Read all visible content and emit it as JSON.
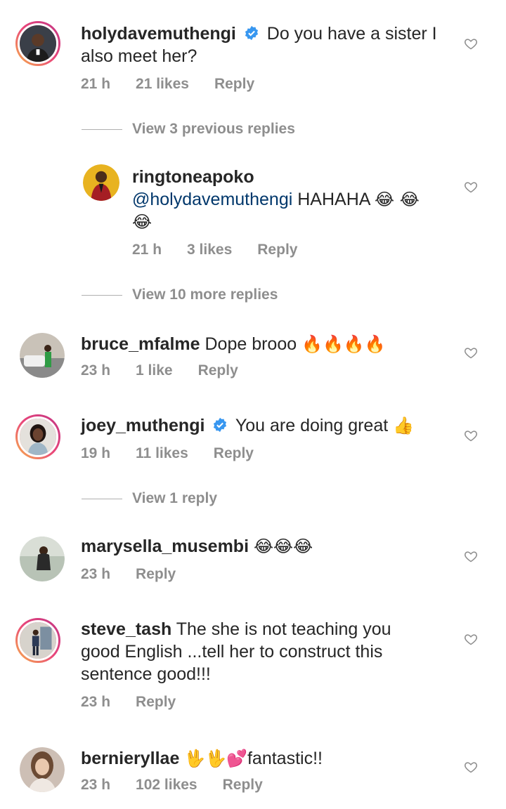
{
  "comments": [
    {
      "username": "holydavemuthengi",
      "verified": true,
      "text": "Do you have a sister I also meet her?",
      "time": "21 h",
      "likes": "21 likes",
      "reply": "Reply",
      "avatar": "man-portrait"
    },
    {
      "username": "ringtoneapoko",
      "mention": "@holydavemuthengi",
      "text": "HAHAHA",
      "emojis": "😂 😂",
      "emojis2": "😂",
      "time": "21 h",
      "likes": "3 likes",
      "reply": "Reply",
      "avatar": "man-red-suit"
    },
    {
      "username": "bruce_mfalme",
      "text": "Dope brooo",
      "emojis": "🔥🔥🔥🔥",
      "time": "23 h",
      "likes": "1 like",
      "reply": "Reply",
      "avatar": "man-with-car"
    },
    {
      "username": "joey_muthengi",
      "verified": true,
      "text": "You are doing great",
      "emojis": "👍",
      "time": "19 h",
      "likes": "11 likes",
      "reply": "Reply",
      "avatar": "woman-portrait"
    },
    {
      "username": "marysella_musembi",
      "emojis": "😂😂😂",
      "time": "23 h",
      "reply": "Reply",
      "avatar": "woman-sitting"
    },
    {
      "username": "steve_tash",
      "text_line1": "The she is not teaching you",
      "text_line2": "good English ...tell her to construct this",
      "text_line3": "sentence good!!!",
      "time": "23 h",
      "reply": "Reply",
      "avatar": "man-standing"
    },
    {
      "username": "bernieryllae",
      "emojis": "🖖🖖💕",
      "text": "fantastic!!",
      "time": "23 h",
      "likes": "102 likes",
      "reply": "Reply",
      "avatar": "woman-selfie"
    }
  ],
  "view_previous": "View 3 previous replies",
  "view_more": "View 10 more replies",
  "view_one": "View 1 reply",
  "colors": {
    "text": "#262626",
    "meta": "#8e8e8e",
    "mention": "#00376b",
    "verified": "#3897f0"
  }
}
